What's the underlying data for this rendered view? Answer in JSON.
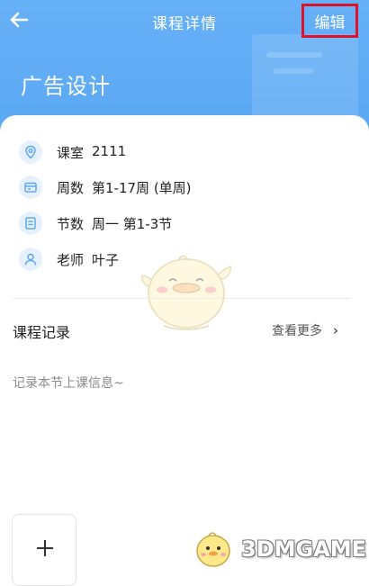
{
  "header": {
    "title": "课程详情",
    "edit_label": "编辑",
    "back_icon": "arrow-left-icon",
    "course_name": "广告设计"
  },
  "info": [
    {
      "icon": "location-pin-icon",
      "label": "课室",
      "value": "2111"
    },
    {
      "icon": "calendar-card-icon",
      "label": "周数",
      "value": "第1-17周 (单周)"
    },
    {
      "icon": "document-list-icon",
      "label": "节数",
      "value": "周一 第1-3节"
    },
    {
      "icon": "person-icon",
      "label": "老师",
      "value": "叶子"
    }
  ],
  "records": {
    "title": "课程记录",
    "more_label": "查看更多",
    "more_icon": "chevron-right-icon",
    "empty_hint": "记录本节上课信息~"
  },
  "add_button": {
    "icon": "plus-icon"
  },
  "watermark": {
    "text": "3DMGAME"
  },
  "colors": {
    "header_blue": "#5aa8f3",
    "edit_highlight": "#e0122a",
    "icon_blue": "#5aa8f3",
    "icon_bg": "#e6f1fd"
  }
}
